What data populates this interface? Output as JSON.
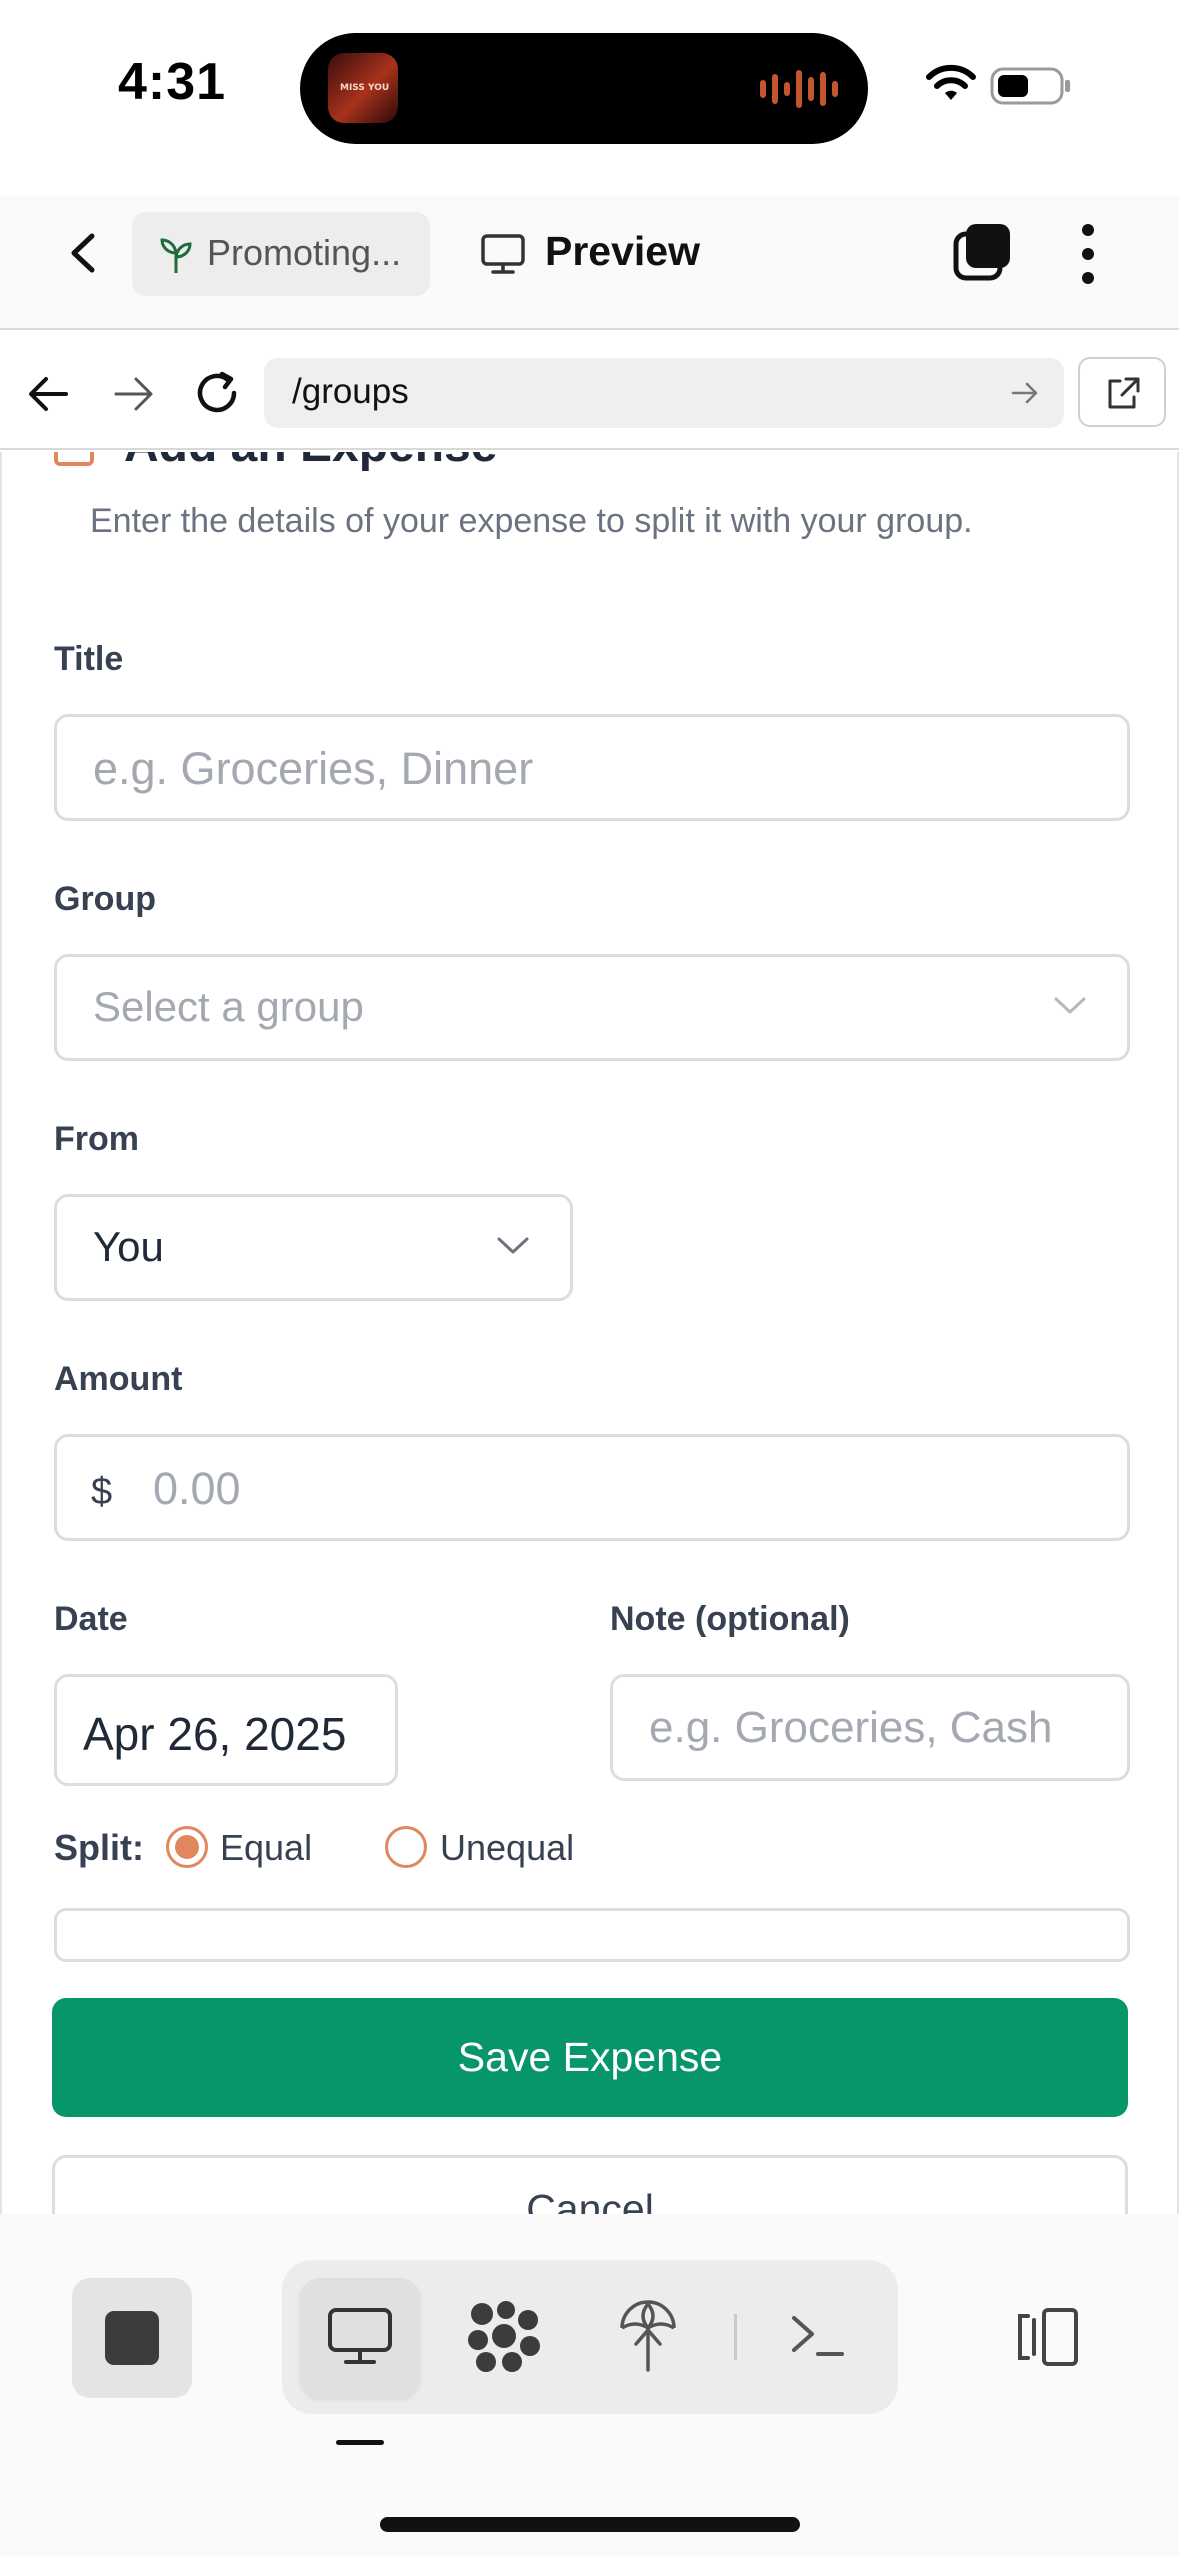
{
  "status_bar": {
    "time": "4:31",
    "album_art_text": "MISS YOU"
  },
  "app_bar": {
    "project_chip": "Promoting...",
    "preview_label": "Preview"
  },
  "browser": {
    "url": "/groups"
  },
  "form": {
    "heading": "Add an Expense",
    "description": "Enter the details of your expense to split it with your group.",
    "title_label": "Title",
    "title_placeholder": "e.g. Groceries, Dinner",
    "group_label": "Group",
    "group_placeholder": "Select a group",
    "from_label": "From",
    "from_value": "You",
    "amount_label": "Amount",
    "currency_symbol": "$",
    "amount_placeholder": "0.00",
    "date_label": "Date",
    "date_value": "Apr 26, 2025",
    "note_label": "Note (optional)",
    "note_placeholder": "e.g. Groceries, Cash",
    "split_label": "Split:",
    "split_options": [
      "Equal",
      "Unequal"
    ],
    "split_selected": "Equal",
    "save_label": "Save Expense",
    "cancel_label": "Cancel"
  },
  "colors": {
    "accent_green": "#079669",
    "radio_orange": "#e0875e",
    "text_dark": "#1f2937"
  },
  "icons": [
    "back-chevron-icon",
    "sprout-icon",
    "monitor-icon",
    "tabs-icon",
    "more-vertical-icon",
    "arrow-left-icon",
    "arrow-right-icon",
    "reload-icon",
    "external-link-icon",
    "stop-icon",
    "desktop-icon",
    "nodes-icon",
    "publish-icon",
    "terminal-icon",
    "device-layout-icon"
  ]
}
